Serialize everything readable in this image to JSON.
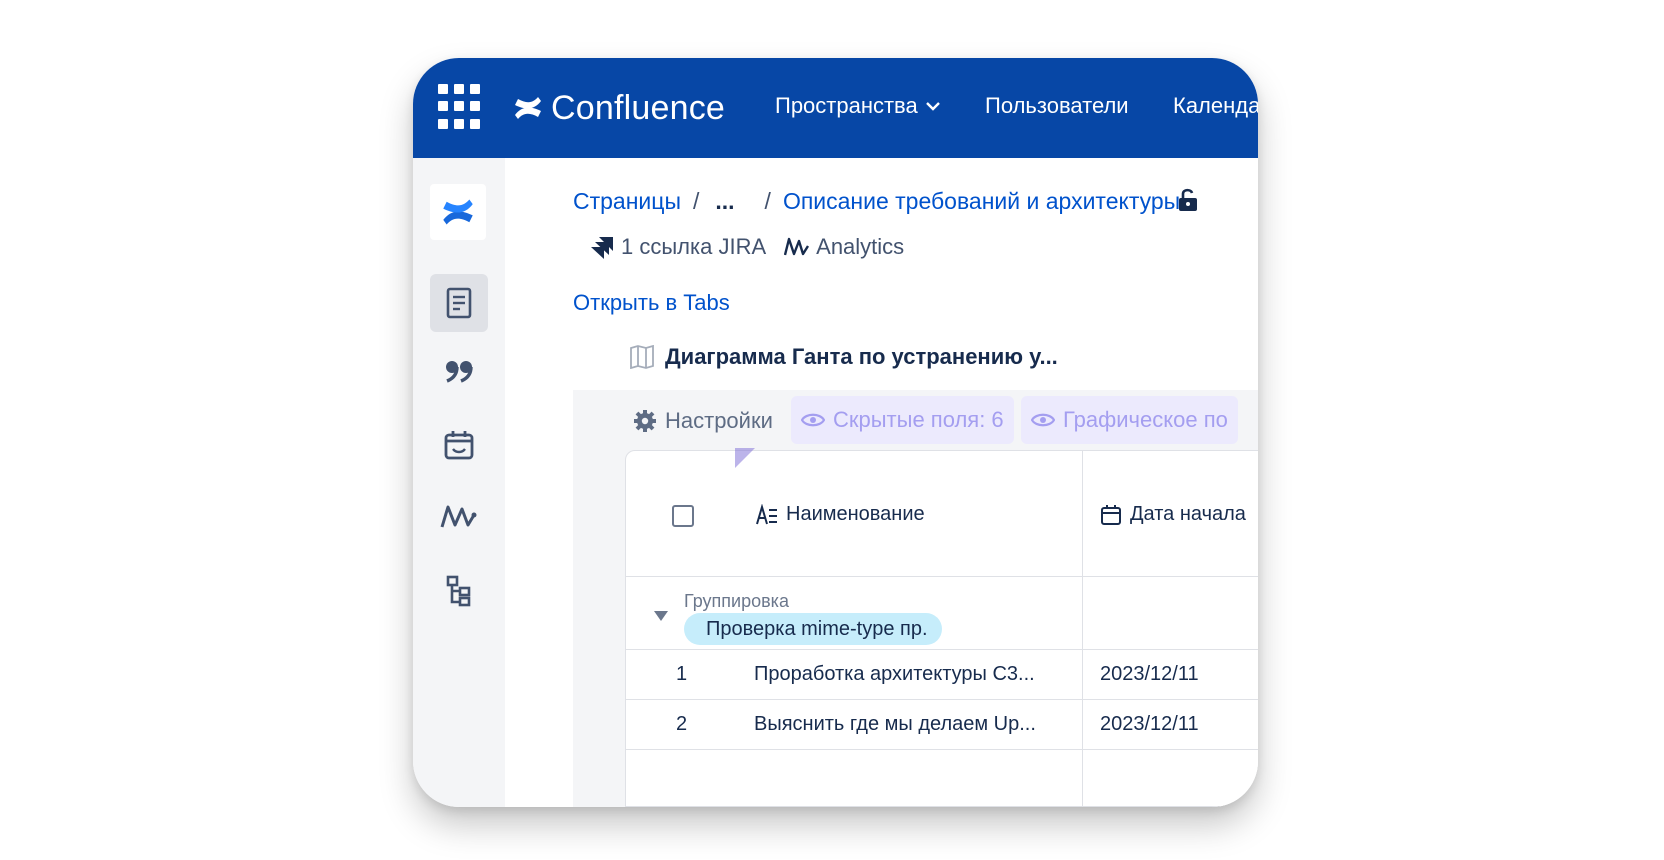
{
  "topnav": {
    "logo_text": "Confluence",
    "items": [
      "Пространства",
      "Пользователи",
      "Календа"
    ],
    "background": "#0747a6"
  },
  "rail": {
    "icons": [
      "confluence-logo-icon",
      "pages-icon",
      "quote-icon",
      "calendar-icon",
      "analytics-icon",
      "tree-icon"
    ]
  },
  "breadcrumbs": {
    "root": "Страницы",
    "sep1": "/",
    "ellipsis": "...",
    "sep2": "/",
    "current": "Описание требований и архитектуры"
  },
  "meta": {
    "jira": "1 ссылка JIRA",
    "analytics": "Analytics"
  },
  "open_tabs": "Открыть в Tabs",
  "gantt_title": "Диаграмма Ганта по устранению у...",
  "toolbar": {
    "settings": "Настройки",
    "hidden_fields": "Скрытые поля: 6",
    "graph": "Графическое по"
  },
  "table": {
    "columns": [
      "Наименование",
      "Дата начала"
    ],
    "group_label": "Группировка",
    "group_value": "Проверка mime-type пр.",
    "rows": [
      {
        "num": "1",
        "name": "Проработка архитектуры С3...",
        "date": "2023/12/11"
      },
      {
        "num": "2",
        "name": "Выяснить где мы делаем Up...",
        "date": "2023/12/11"
      }
    ]
  }
}
